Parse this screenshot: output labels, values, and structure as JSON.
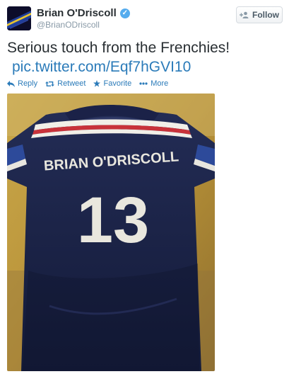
{
  "tweet": {
    "author_name": "Brian O'Driscoll",
    "handle": "@BrianODriscoll",
    "verified_mark": "✓",
    "text": "Serious touch from the Frenchies!",
    "link": "pic.twitter.com/Eqf7hGVI10",
    "follow_label": "Follow",
    "actions": {
      "reply": "Reply",
      "retweet": "Retweet",
      "favorite": "Favorite",
      "more": "More"
    },
    "photo": {
      "jersey_name": "BRIAN O'DRISCOLL",
      "jersey_number": "13"
    }
  },
  "colors": {
    "link": "#2b7bb9",
    "verified": "#55acee",
    "jersey": "#1a2145"
  },
  "icons": [
    "follow-person-icon",
    "verified-badge-icon",
    "reply-icon",
    "retweet-icon",
    "favorite-star-icon",
    "more-dots-icon"
  ]
}
